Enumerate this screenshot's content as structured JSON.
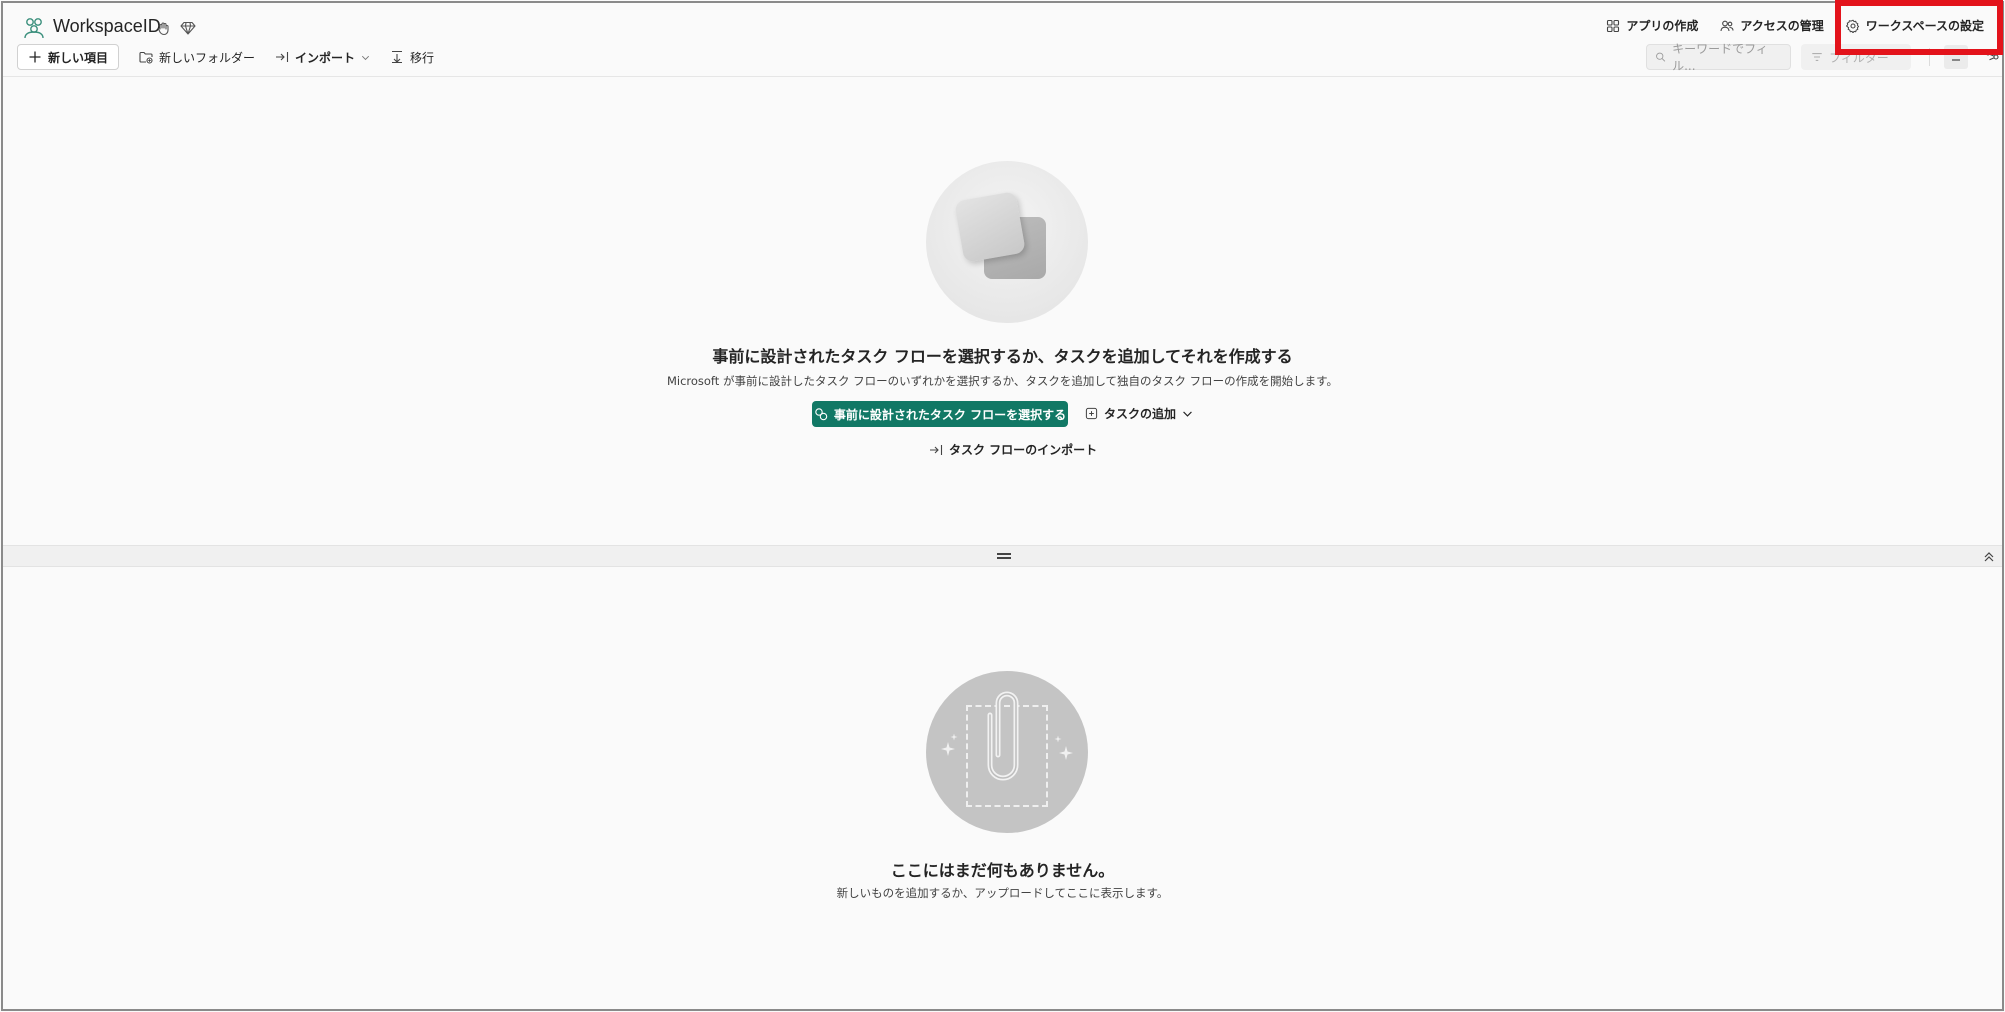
{
  "header": {
    "workspace_name": "WorkspaceID",
    "actions": [
      {
        "label": "アプリの作成",
        "icon": "grid-icon"
      },
      {
        "label": "アクセスの管理",
        "icon": "people-icon"
      },
      {
        "label": "ワークスペースの設定",
        "icon": "gear-icon"
      }
    ]
  },
  "toolbar": {
    "new_item": "新しい項目",
    "new_folder": "新しいフォルダー",
    "import": "インポート",
    "migrate": "移行",
    "search_placeholder": "キーワードでフィル...",
    "filter_label": "フィルター"
  },
  "task_flow": {
    "title": "事前に設計されたタスク フローを選択するか、タスクを追加してそれを作成する",
    "subtitle": "Microsoft が事前に設計したタスク フローのいずれかを選択するか、タスクを追加して独自のタスク フローの作成を開始します。",
    "primary_button": "事前に設計されたタスク フローを選択する",
    "add_task": "タスクの追加",
    "import_flow": "タスク フローのインポート"
  },
  "empty_state": {
    "title": "ここにはまだ何もありません。",
    "subtitle": "新しいものを追加するか、アップロードしてここに表示します。"
  },
  "colors": {
    "primary": "#117865",
    "highlight": "#e3131b",
    "background": "#fafafa"
  }
}
